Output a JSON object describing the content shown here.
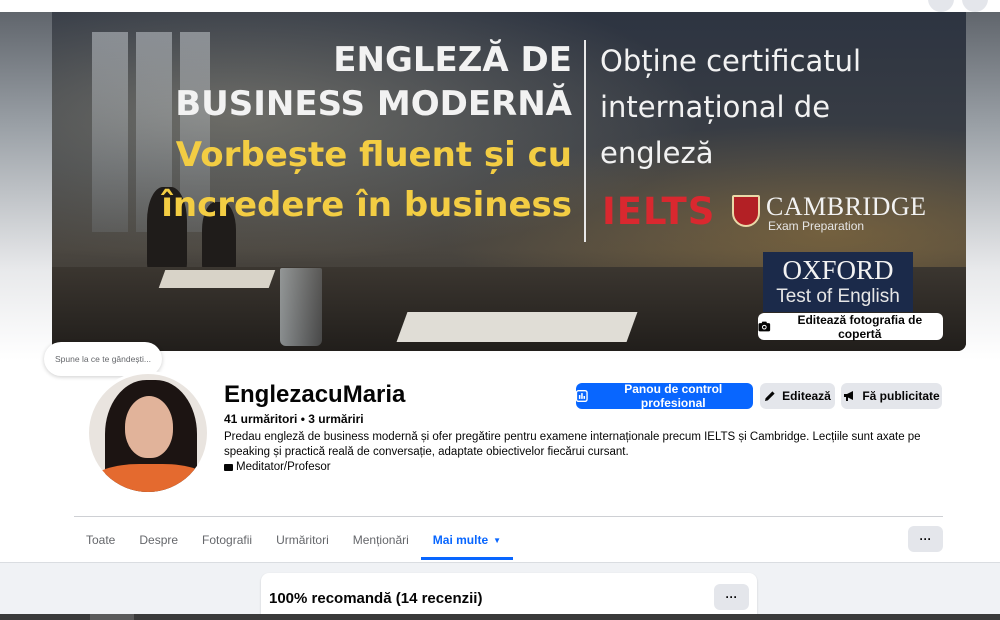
{
  "cover": {
    "headline_line1": "ENGLEZĂ DE",
    "headline_line2": "BUSINESS MODERNĂ",
    "headline_line3": "Vorbește fluent și cu",
    "headline_line4": "încredere în business",
    "right_line1": "Obține certificatul",
    "right_line2": "internațional de",
    "right_line3": "engleză",
    "ielts": "IELTS",
    "cambridge": "CAMBRIDGE",
    "cambridge_sub": "Exam Preparation",
    "oxford_title": "OXFORD",
    "oxford_sub": "Test of English",
    "edit_cover_label": "Editează fotografia de copertă"
  },
  "thought_bubble": "Spune la ce te gândești...",
  "profile": {
    "name": "EnglezacuMaria",
    "followers": "41 urmăritori",
    "following": "3 urmăriri",
    "separator": " • ",
    "bio": "Predau engleză de business modernă și ofer pregătire pentru examene internaționale precum IELTS și Cambridge. Lecțiile sunt axate pe speaking și practică reală de conversație, adaptate obiectivelor fiecărui cursant.",
    "category": "Meditator/Profesor"
  },
  "actions": {
    "dashboard": "Panou de control profesional",
    "edit": "Editează",
    "advertise": "Fă publicitate"
  },
  "tabs": [
    {
      "label": "Toate"
    },
    {
      "label": "Despre"
    },
    {
      "label": "Fotografii"
    },
    {
      "label": "Urmăritori"
    },
    {
      "label": "Menționări"
    },
    {
      "label": "Mai multe"
    }
  ],
  "more_label": "···",
  "card": {
    "title": "100% recomandă (14 recenzii)",
    "more_label": "···"
  },
  "colors": {
    "accent": "#0866ff",
    "headline_yellow": "#f3cd43",
    "ielts_red": "#d9282f"
  }
}
